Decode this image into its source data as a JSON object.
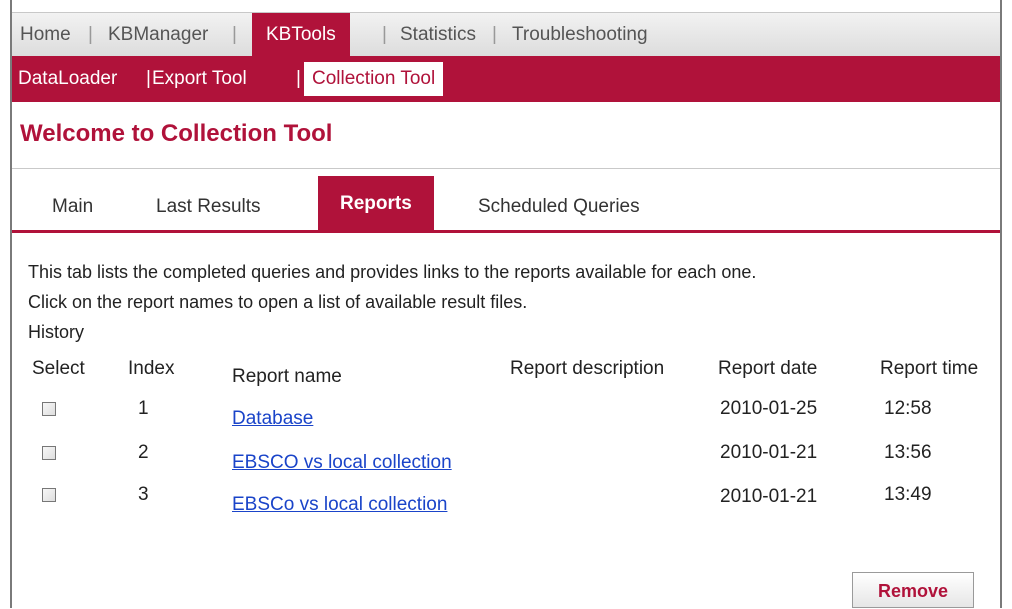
{
  "topnav": {
    "items": [
      "Home",
      "KBManager",
      "KBTools",
      "Statistics",
      "Troubleshooting"
    ],
    "active": "KBTools"
  },
  "subnav": {
    "items": [
      "DataLoader",
      "Export Tool",
      "Collection Tool"
    ],
    "selected": "Collection Tool"
  },
  "page": {
    "title": "Welcome to Collection Tool"
  },
  "tabs": [
    "Main",
    "Last Results",
    "Reports",
    "Scheduled Queries"
  ],
  "content": {
    "line1": "This tab lists the completed queries and provides links to the reports available for each one.",
    "line2": "Click on the report names to open a list of available result files.",
    "history": "History"
  },
  "table": {
    "headers": {
      "select": "Select",
      "index": "Index",
      "name": "Report name",
      "description": "Report description",
      "date": "Report date",
      "time": "Report time"
    },
    "rows": [
      {
        "index": "1",
        "name": "Database",
        "date": "2010-01-25",
        "time": "12:58"
      },
      {
        "index": "2",
        "name": "EBSCO vs local collection",
        "date": "2010-01-21",
        "time": "13:56"
      },
      {
        "index": "3",
        "name": "EBSCo vs local collection",
        "date": "2010-01-21",
        "time": "13:49"
      }
    ]
  },
  "actions": {
    "remove": "Remove"
  },
  "colors": {
    "accent": "#b0123a",
    "link": "#1a44c9"
  }
}
